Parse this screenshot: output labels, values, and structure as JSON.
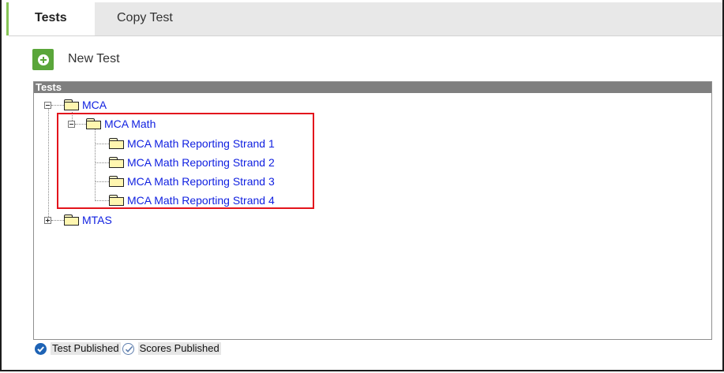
{
  "tabs": [
    {
      "label": "Tests",
      "active": true
    },
    {
      "label": "Copy Test",
      "active": false
    }
  ],
  "toolbar": {
    "new_test_label": "New Test"
  },
  "panel": {
    "header": "Tests"
  },
  "tree": {
    "mca": {
      "label": "MCA",
      "expanded": true
    },
    "mca_math": {
      "label": "MCA Math",
      "expanded": true
    },
    "strands": [
      {
        "label": "MCA Math Reporting Strand 1"
      },
      {
        "label": "MCA Math Reporting Strand 2"
      },
      {
        "label": "MCA Math Reporting Strand 3"
      },
      {
        "label": "MCA Math Reporting Strand 4"
      }
    ],
    "mtas": {
      "label": "MTAS",
      "expanded": false
    }
  },
  "legend": {
    "test_published": "Test Published",
    "scores_published": "Scores Published"
  },
  "colors": {
    "accent_green": "#3e7d2b",
    "link_blue": "#0f1fe0",
    "highlight_red": "#e3141c",
    "header_gray": "#7f7f7f"
  }
}
